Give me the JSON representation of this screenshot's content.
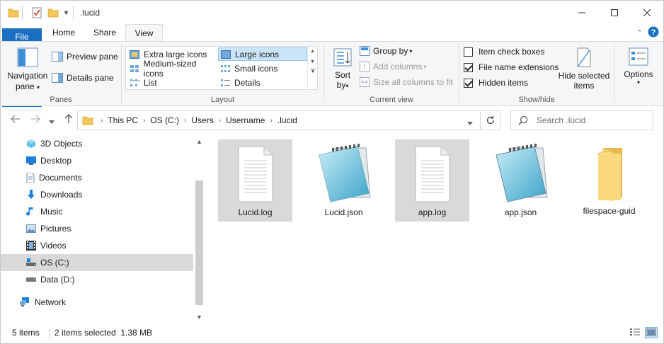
{
  "window": {
    "title": ".lucid",
    "controls": {
      "minimize": "minimize-icon",
      "maximize": "maximize-icon",
      "close": "close-icon"
    }
  },
  "tabs": [
    {
      "label": "File",
      "kind": "file"
    },
    {
      "label": "Home"
    },
    {
      "label": "Share"
    },
    {
      "label": "View",
      "active": true
    }
  ],
  "ribbon": {
    "panes": {
      "navigation_pane": "Navigation",
      "navigation_pane_2": "pane",
      "preview_pane": "Preview pane",
      "details_pane": "Details pane",
      "label": "Panes"
    },
    "layout": {
      "items": [
        "Extra large icons",
        "Large icons",
        "Medium-sized icons",
        "Small icons",
        "List",
        "Details"
      ],
      "selected": "Large icons",
      "label": "Layout"
    },
    "current_view": {
      "sort_by": "Sort",
      "sort_by_2": "by",
      "group_by": "Group by",
      "add_columns": "Add columns",
      "size_columns": "Size all columns to fit",
      "label": "Current view"
    },
    "show_hide": {
      "item_check_boxes": {
        "label": "Item check boxes",
        "checked": false
      },
      "file_name_extensions": {
        "label": "File name extensions",
        "checked": true
      },
      "hidden_items": {
        "label": "Hidden items",
        "checked": true
      },
      "hide_selected": "Hide selected",
      "hide_selected_2": "items",
      "label": "Show/hide"
    },
    "options": {
      "label": "Options"
    }
  },
  "address": {
    "crumbs": [
      "This PC",
      "OS (C:)",
      "Users",
      "Username",
      ".lucid"
    ],
    "search_placeholder": "Search .lucid"
  },
  "nav": {
    "items": [
      {
        "label": "3D Objects",
        "icon": "3d-objects-icon"
      },
      {
        "label": "Desktop",
        "icon": "desktop-icon"
      },
      {
        "label": "Documents",
        "icon": "documents-icon"
      },
      {
        "label": "Downloads",
        "icon": "downloads-icon"
      },
      {
        "label": "Music",
        "icon": "music-icon"
      },
      {
        "label": "Pictures",
        "icon": "pictures-icon"
      },
      {
        "label": "Videos",
        "icon": "videos-icon"
      },
      {
        "label": "OS (C:)",
        "icon": "drive-icon",
        "selected": true
      },
      {
        "label": "Data (D:)",
        "icon": "drive-icon"
      },
      {
        "label": "Network",
        "icon": "network-icon"
      }
    ]
  },
  "files": [
    {
      "name": "Lucid.log",
      "type": "text",
      "selected": true
    },
    {
      "name": "Lucid.json",
      "type": "notepad",
      "selected": false
    },
    {
      "name": "app.log",
      "type": "text",
      "selected": true
    },
    {
      "name": "app.json",
      "type": "notepad",
      "selected": false
    },
    {
      "name": "filespace-guid",
      "type": "folder",
      "selected": false
    }
  ],
  "status": {
    "item_count": "5 items",
    "selection": "2 items selected  1.38 MB"
  },
  "colors": {
    "accent": "#1a6fc2",
    "selection": "#d9d9d9",
    "ribbon_bg": "#f5f6f7"
  }
}
